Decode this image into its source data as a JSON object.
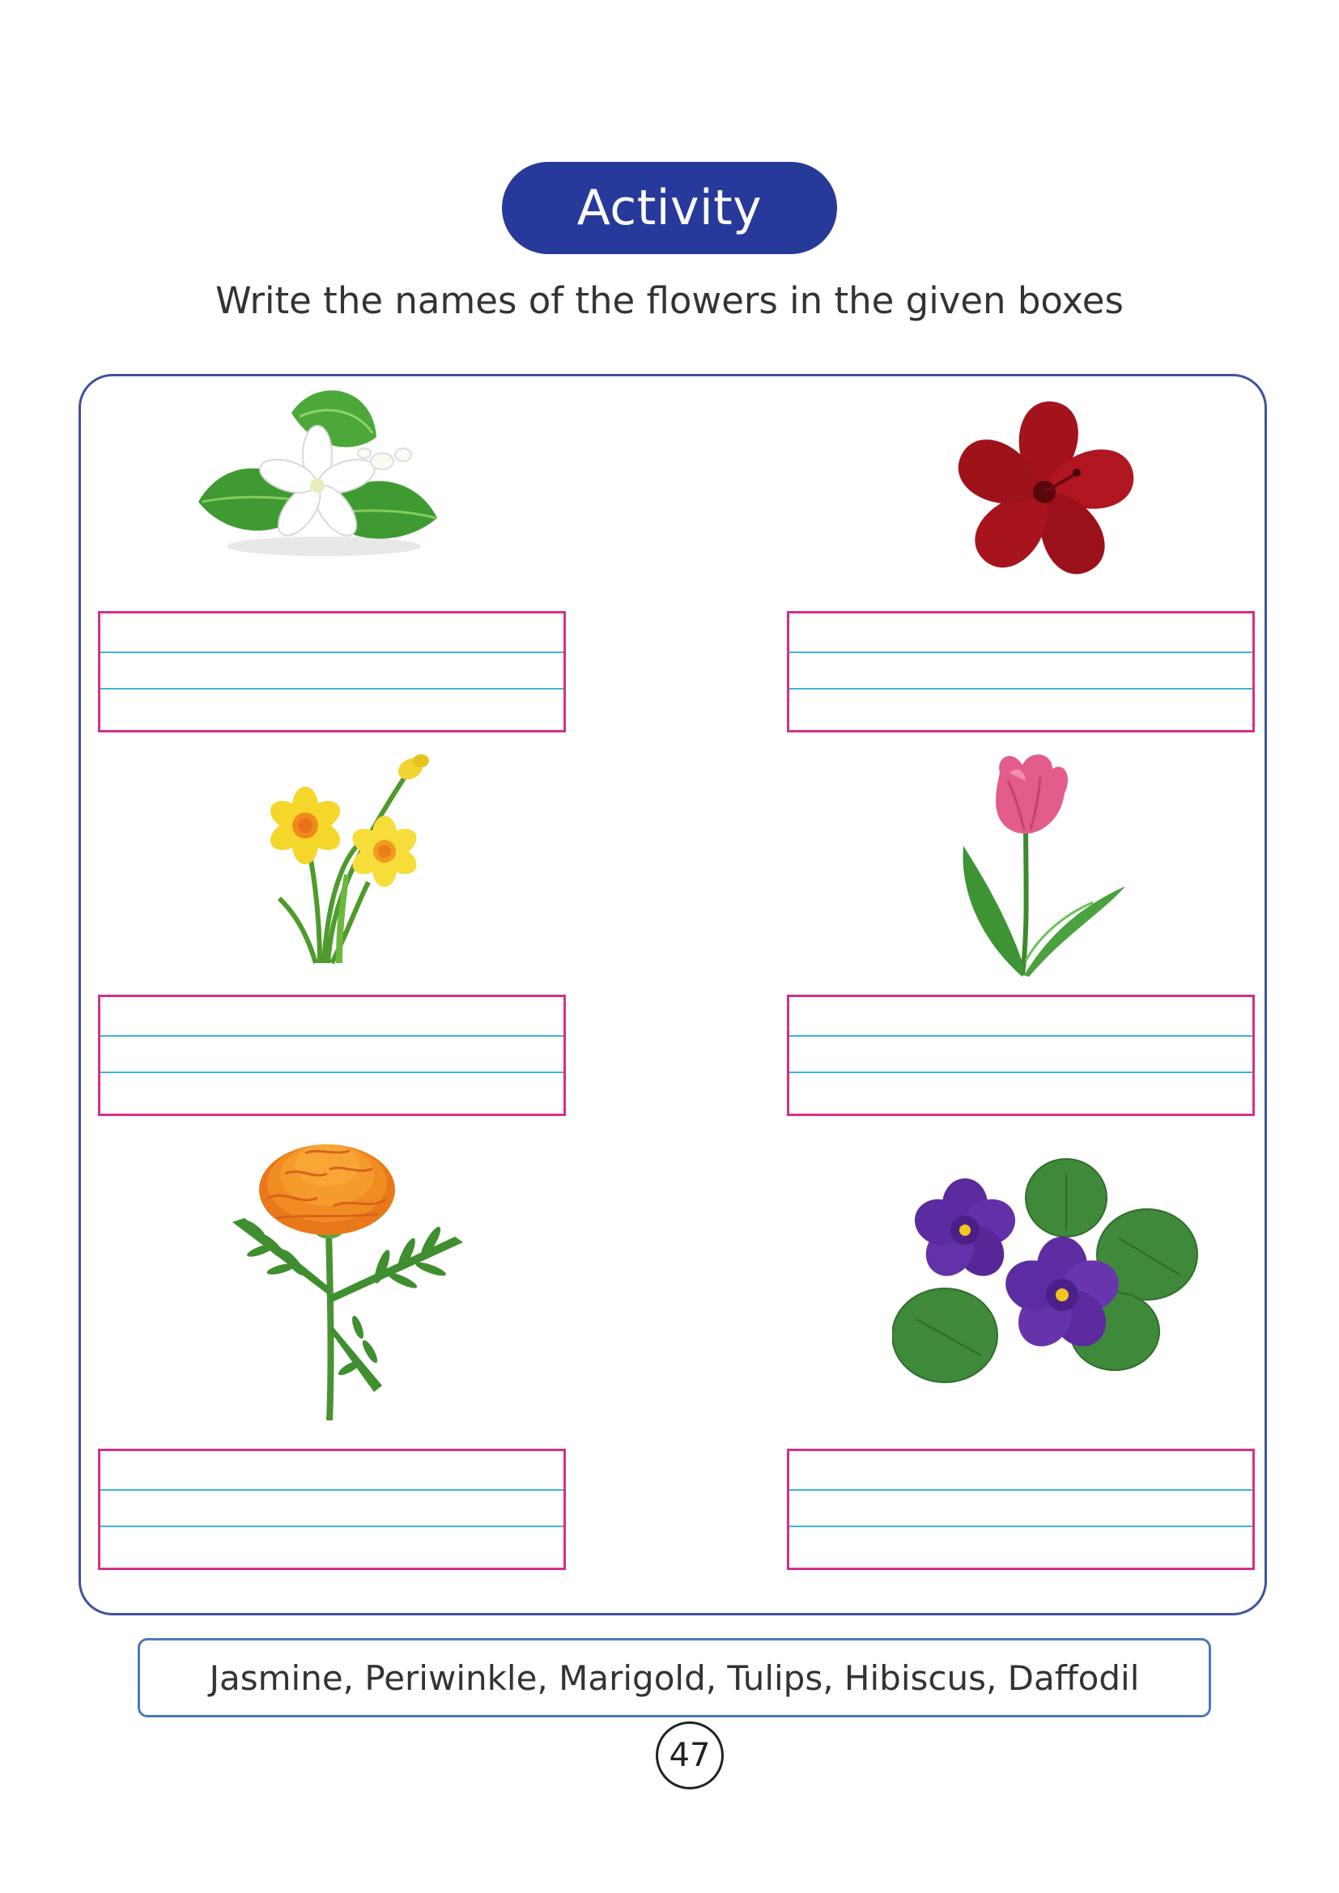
{
  "header": {
    "badge": "Activity"
  },
  "instruction": "Write the names of the flowers in the given boxes",
  "flowers": [
    {
      "icon": "jasmine-icon"
    },
    {
      "icon": "hibiscus-icon"
    },
    {
      "icon": "daffodil-icon"
    },
    {
      "icon": "tulip-icon"
    },
    {
      "icon": "marigold-icon"
    },
    {
      "icon": "periwinkle-icon"
    }
  ],
  "word_bank": "Jasmine, Periwinkle, Marigold, Tulips, Hibiscus, Daffodil",
  "page_number": "47",
  "colors": {
    "badge_bg": "#27399a",
    "frame_border": "#3f51a0",
    "box_border": "#d4308a",
    "box_lines": "#3db4d8",
    "word_bank_border": "#4e79b8"
  }
}
